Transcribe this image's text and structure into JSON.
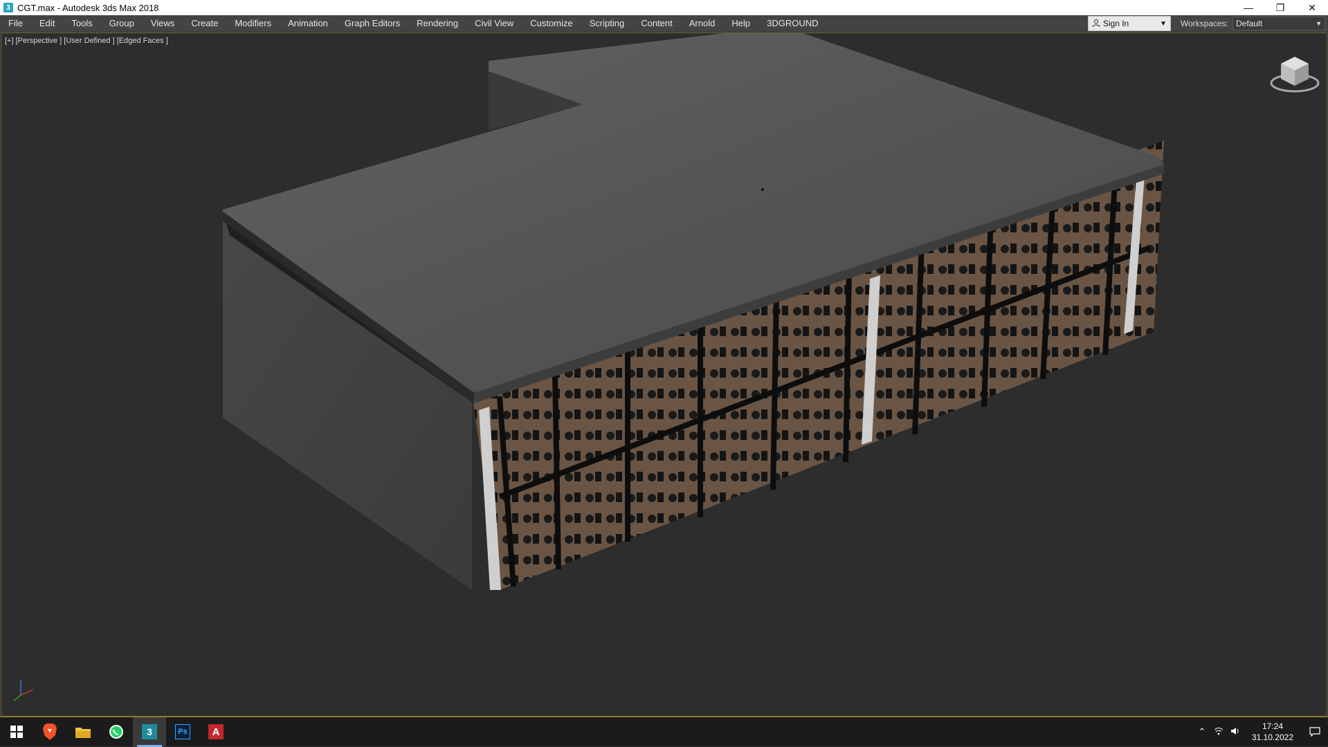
{
  "window": {
    "title": "CGT.max - Autodesk 3ds Max 2018",
    "icon_glyph": "3",
    "minimize_glyph": "—",
    "restore_glyph": "❐",
    "close_glyph": "✕"
  },
  "menu": {
    "items": [
      {
        "label": "File"
      },
      {
        "label": "Edit"
      },
      {
        "label": "Tools"
      },
      {
        "label": "Group"
      },
      {
        "label": "Views"
      },
      {
        "label": "Create"
      },
      {
        "label": "Modifiers"
      },
      {
        "label": "Animation"
      },
      {
        "label": "Graph Editors"
      },
      {
        "label": "Rendering"
      },
      {
        "label": "Civil View"
      },
      {
        "label": "Customize"
      },
      {
        "label": "Scripting"
      },
      {
        "label": "Content"
      },
      {
        "label": "Arnold"
      },
      {
        "label": "Help"
      },
      {
        "label": "3DGROUND"
      }
    ],
    "sign_in": "Sign In",
    "workspaces_label": "Workspaces:",
    "workspace_value": "Default"
  },
  "viewport": {
    "label": "[+] [Perspective ] [User Defined ] [Edged Faces ]"
  },
  "taskbar": {
    "apps": [
      {
        "name": "start-icon",
        "active": false
      },
      {
        "name": "brave-browser-icon",
        "active": false
      },
      {
        "name": "file-explorer-icon",
        "active": false
      },
      {
        "name": "whatsapp-icon",
        "active": false
      },
      {
        "name": "3ds-max-icon",
        "active": true
      },
      {
        "name": "photoshop-icon",
        "active": false
      },
      {
        "name": "autocad-icon",
        "active": false
      }
    ],
    "ps_text": "Ps",
    "acad_text": "A",
    "max_text": "3",
    "time": "17:24",
    "date": "31.10.2022"
  },
  "colors": {
    "menubar": "#444444",
    "viewport_bg": "#2d2d2d",
    "taskbar": "#1b1b1b",
    "roof": "#5a5a5a",
    "floor": "#6b5646"
  }
}
